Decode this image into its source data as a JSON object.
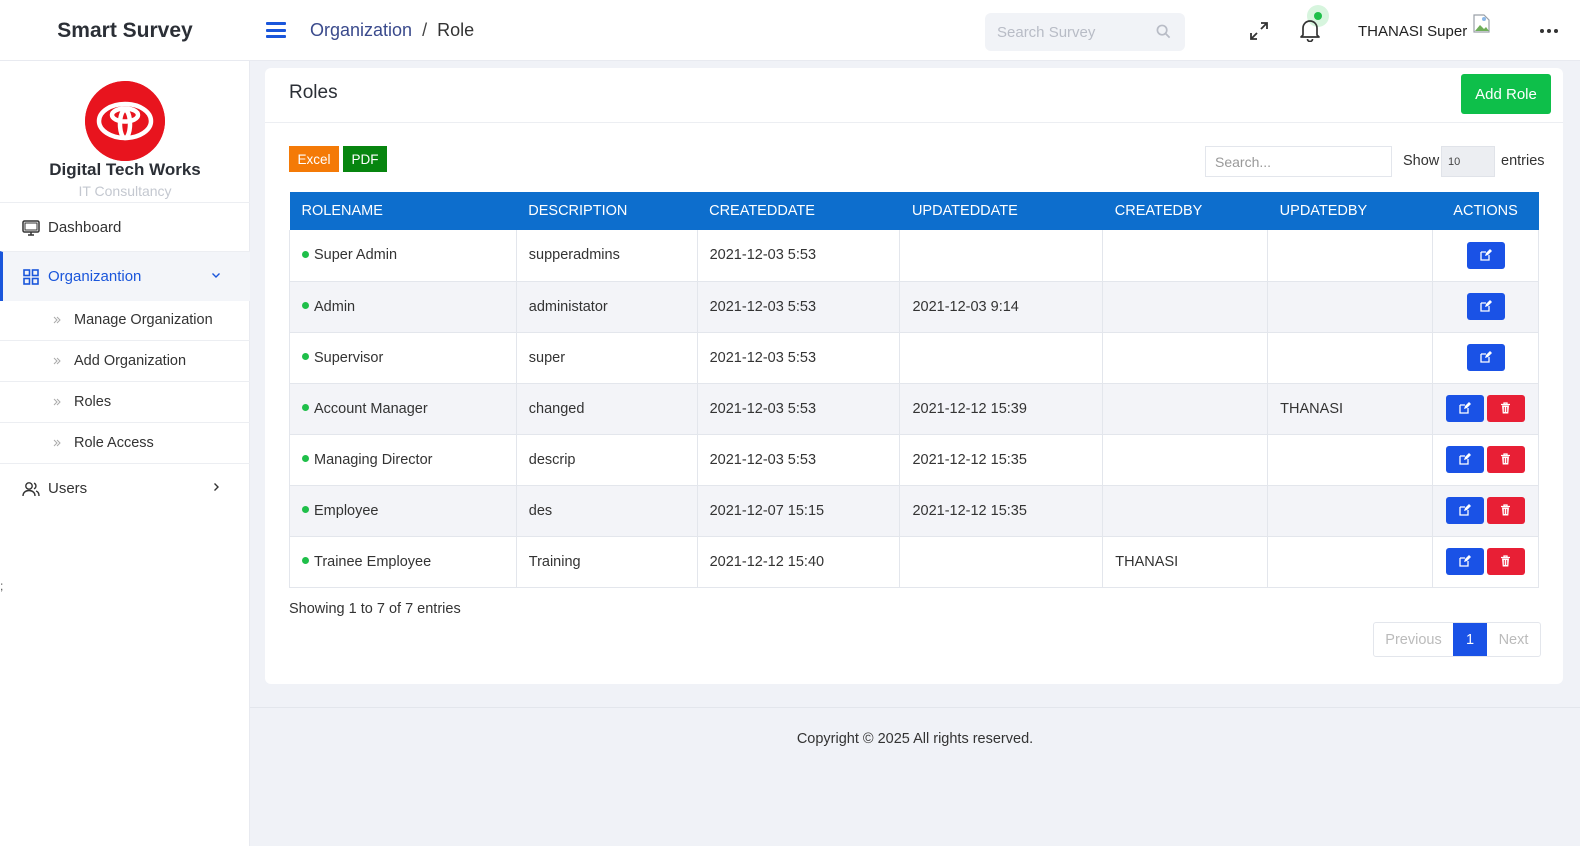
{
  "header": {
    "brand": "Smart Survey",
    "breadcrumb": {
      "parent": "Organization",
      "separator": "/",
      "current": "Role"
    },
    "search_placeholder": "Search Survey",
    "username": "THANASI Super"
  },
  "sidebar": {
    "org_name": "Digital Tech Works",
    "org_subtitle": "IT Consultancy",
    "items": [
      {
        "label": "Dashboard",
        "icon": "monitor-icon"
      },
      {
        "label": "Organizantion",
        "icon": "grid-icon",
        "active": true,
        "expanded": true
      },
      {
        "label": "Users",
        "icon": "users-icon"
      }
    ],
    "sub_items": [
      "Manage Organization",
      "Add Organization",
      "Roles",
      "Role Access"
    ],
    "stray_text": ";"
  },
  "card": {
    "title": "Roles",
    "add_button": "Add Role",
    "excel_button": "Excel",
    "pdf_button": "PDF",
    "search_placeholder": "Search...",
    "show_label": "Show",
    "page_size": "10",
    "entries_label": "entries"
  },
  "table": {
    "columns": [
      "ROLENAME",
      "DESCRIPTION",
      "CREATEDDATE",
      "UPDATEDDATE",
      "CREATEDBY",
      "UPDATEDBY",
      "ACTIONS"
    ],
    "rows": [
      {
        "rolename": "Super Admin",
        "description": "supperadmins",
        "createddate": "2021-12-03 5:53",
        "updateddate": "",
        "createdby": "",
        "updatedby": "",
        "deletable": false
      },
      {
        "rolename": "Admin",
        "description": "administator",
        "createddate": "2021-12-03 5:53",
        "updateddate": "2021-12-03 9:14",
        "createdby": "",
        "updatedby": "",
        "deletable": false
      },
      {
        "rolename": "Supervisor",
        "description": "super",
        "createddate": "2021-12-03 5:53",
        "updateddate": "",
        "createdby": "",
        "updatedby": "",
        "deletable": false
      },
      {
        "rolename": "Account Manager",
        "description": "changed",
        "createddate": "2021-12-03 5:53",
        "updateddate": "2021-12-12 15:39",
        "createdby": "",
        "updatedby": "THANASI",
        "deletable": true
      },
      {
        "rolename": "Managing Director",
        "description": "descrip",
        "createddate": "2021-12-03 5:53",
        "updateddate": "2021-12-12 15:35",
        "createdby": "",
        "updatedby": "",
        "deletable": true
      },
      {
        "rolename": "Employee",
        "description": "des",
        "createddate": "2021-12-07 15:15",
        "updateddate": "2021-12-12 15:35",
        "createdby": "",
        "updatedby": "",
        "deletable": true
      },
      {
        "rolename": "Trainee Employee",
        "description": "Training",
        "createddate": "2021-12-12 15:40",
        "updateddate": "",
        "createdby": "THANASI",
        "updatedby": "",
        "deletable": true
      }
    ]
  },
  "pagination": {
    "info": "Showing 1 to 7 of 7 entries",
    "previous": "Previous",
    "current": "1",
    "next": "Next"
  },
  "footer": {
    "text": "Copyright © 2025 All rights reserved."
  },
  "colors": {
    "primary": "#1a52e6",
    "header_blue": "#0d6ecd",
    "success": "#0ebf4a",
    "danger": "#e81f35",
    "excel": "#f47a07",
    "pdf": "#07850f"
  }
}
